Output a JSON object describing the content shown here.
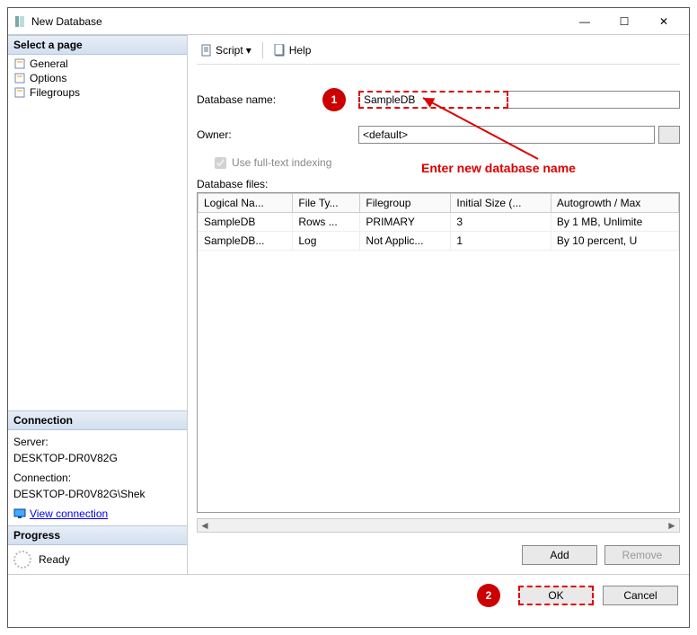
{
  "window": {
    "title": "New Database"
  },
  "win_buttons": {
    "min": "—",
    "max": "☐",
    "close": "✕"
  },
  "sidebar": {
    "pages_header": "Select a page",
    "pages": [
      {
        "label": "General",
        "icon": "general-icon"
      },
      {
        "label": "Options",
        "icon": "options-icon"
      },
      {
        "label": "Filegroups",
        "icon": "filegroups-icon"
      }
    ],
    "connection_header": "Connection",
    "server_label": "Server:",
    "server_value": "DESKTOP-DR0V82G",
    "connection_label": "Connection:",
    "connection_value": "DESKTOP-DR0V82G\\Shek",
    "view_connection": "View connection ",
    "progress_header": "Progress",
    "progress_status": "Ready"
  },
  "toolbar": {
    "script_label": "Script",
    "help_label": "Help"
  },
  "form": {
    "dbname_label": "Database name:",
    "dbname_value": "SampleDB",
    "owner_label": "Owner:",
    "owner_value": "<default>",
    "fulltext_label": "Use full-text indexing",
    "files_label": "Database files:"
  },
  "grid": {
    "headers": [
      "Logical Na...",
      "File Ty...",
      "Filegroup",
      "Initial Size (...",
      "Autogrowth / Max"
    ],
    "rows": [
      [
        "SampleDB",
        "Rows ...",
        "PRIMARY",
        "3",
        "By 1 MB, Unlimite"
      ],
      [
        "SampleDB...",
        "Log",
        "Not Applic...",
        "1",
        "By 10 percent, U"
      ]
    ]
  },
  "buttons": {
    "add": "Add",
    "remove": "Remove",
    "ok": "OK",
    "cancel": "Cancel"
  },
  "annotations": {
    "c1": "1",
    "c2": "2",
    "text1": "Enter new database name"
  }
}
